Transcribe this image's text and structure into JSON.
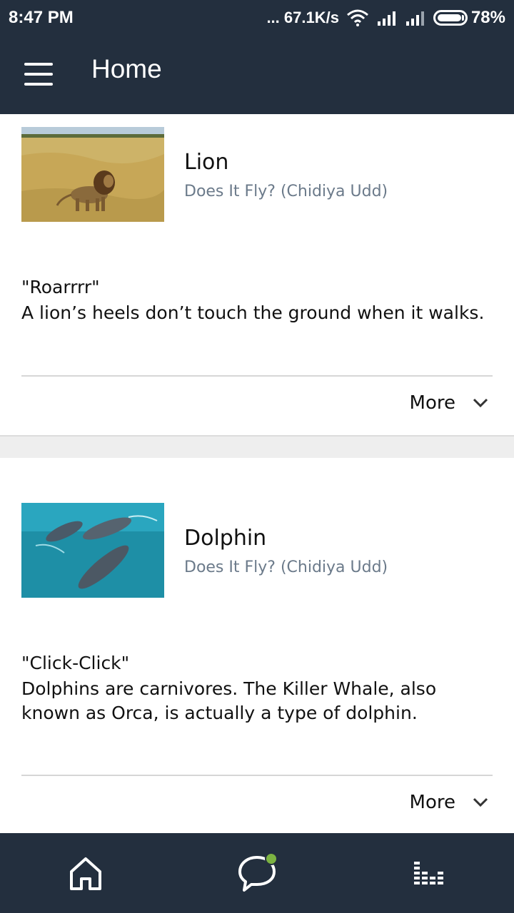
{
  "status_bar": {
    "time": "8:47 PM",
    "network_speed": "... 67.1K/s",
    "battery": "78%",
    "icons": [
      "wifi-icon",
      "signal-icon",
      "signal-icon",
      "battery-icon"
    ]
  },
  "app_bar": {
    "title": "Home",
    "menu_icon": "hamburger-menu-icon"
  },
  "cards": [
    {
      "title": "Lion",
      "subtitle": "Does It Fly? (Chidiya Udd)",
      "sound": "\"Roarrrr\"",
      "fact": "A lion’s heels don’t touch the ground when it walks.",
      "more_label": "More"
    },
    {
      "title": "Dolphin",
      "subtitle": "Does It Fly? (Chidiya Udd)",
      "sound": "\"Click-Click\"",
      "fact": "Dolphins are carnivores. The Killer Whale, also known as Orca, is actually a type of dolphin.",
      "more_label": "More"
    }
  ],
  "bottom_nav": {
    "items": [
      "home-icon",
      "chat-icon",
      "equalizer-icon"
    ],
    "notification_color": "#7cb342"
  },
  "colors": {
    "bar_background": "#232f3e",
    "subtitle": "#6b7a8a"
  }
}
